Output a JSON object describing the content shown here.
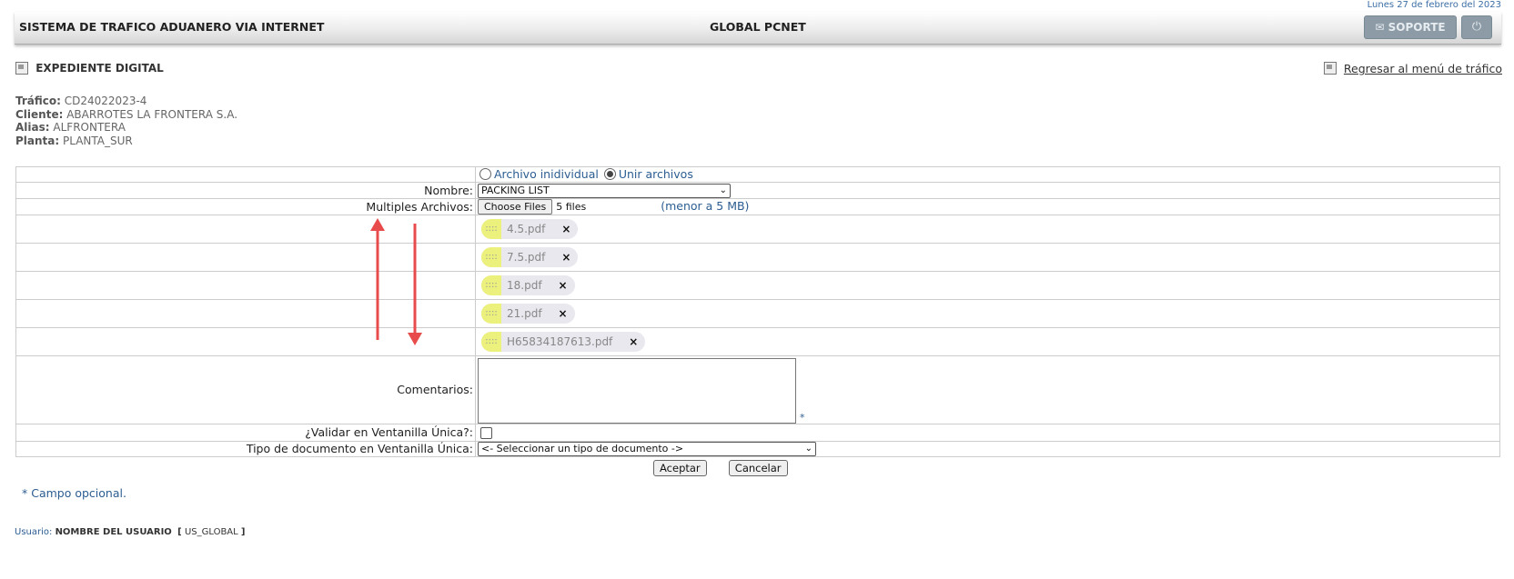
{
  "date": "Lunes 27 de febrero del 2023",
  "header": {
    "system_title": "SISTEMA DE TRAFICO ADUANERO VIA INTERNET",
    "center_title": "GLOBAL PCNET",
    "support_label": "SOPORTE",
    "support_icon": "✉",
    "power_icon": "⏻"
  },
  "section_title": "EXPEDIENTE DIGITAL",
  "back_link": "Regresar al menú de tráfico",
  "info": {
    "trafico_label": "Tráfico:",
    "trafico": "CD24022023-4",
    "cliente_label": "Cliente:",
    "cliente": "ABARROTES LA FRONTERA S.A.",
    "alias_label": "Alias:",
    "alias": "ALFRONTERA",
    "planta_label": "Planta:",
    "planta": "PLANTA_SUR"
  },
  "form": {
    "radio_individual": "Archivo inidividual",
    "radio_unir": "Unir archivos",
    "nombre_label": "Nombre:",
    "nombre_value": "PACKING LIST",
    "multiples_label": "Multiples Archivos:",
    "choose_files": "Choose Files",
    "files_count": "5 files",
    "size_note": "(menor a 5 MB)",
    "files": [
      {
        "name": "4.5.pdf",
        "handle": "::::",
        "remove": "×"
      },
      {
        "name": "7.5.pdf",
        "handle": "::::",
        "remove": "×"
      },
      {
        "name": "18.pdf",
        "handle": "::::",
        "remove": "×"
      },
      {
        "name": "21.pdf",
        "handle": "::::",
        "remove": "×"
      },
      {
        "name": "H65834187613.pdf",
        "handle": "::::",
        "remove": "×"
      }
    ],
    "comentarios_label": "Comentarios:",
    "optional_mark": "*",
    "validar_label": "¿Validar en Ventanilla Única?:",
    "tipo_label": "Tipo de documento en Ventanilla Única:",
    "tipo_value": "<- Seleccionar un tipo de documento ->"
  },
  "buttons": {
    "aceptar": "Aceptar",
    "cancelar": "Cancelar"
  },
  "footnote": "* Campo opcional.",
  "footer": {
    "user_label": "Usuario:",
    "user_name": "NOMBRE DEL USUARIO",
    "user_code": "US_GLOBAL",
    "open_bracket": "[",
    "close_bracket": "]"
  },
  "colors": {
    "accent": "#2b5d91",
    "highlight": "#ecf07c",
    "arrow": "#e84b4b"
  }
}
